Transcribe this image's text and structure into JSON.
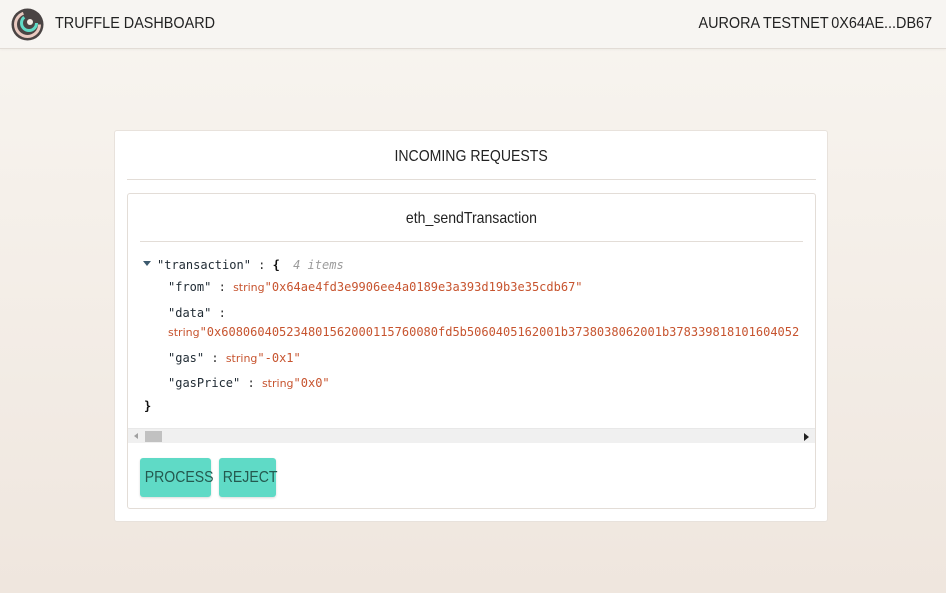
{
  "header": {
    "app_title": "TRUFFLE DASHBOARD",
    "network": "AURORA TESTNET",
    "account": "0X64AE...DB67"
  },
  "panel": {
    "title": "INCOMING REQUESTS"
  },
  "request": {
    "method": "eth_sendTransaction",
    "json": {
      "root_key": "\"transaction\"",
      "root_colon": ":",
      "open_brace": "{",
      "item_count": "4 items",
      "close_brace": "}",
      "fields": [
        {
          "key": "\"from\"",
          "colon": ":",
          "type": "string",
          "value": "\"0x64ae4fd3e9906ee4a0189e3a393d19b3e35cdb67\""
        },
        {
          "key": "\"data\"",
          "colon": ":",
          "type": "string",
          "value": "\"0x608060405234801562000115760080fd5b5060405162001b3738038062001b378339818101604052"
        },
        {
          "key": "\"gas\"",
          "colon": ":",
          "type": "string",
          "value": "\"-0x1\""
        },
        {
          "key": "\"gasPrice\"",
          "colon": ":",
          "type": "string",
          "value": "\"0x0\""
        }
      ]
    }
  },
  "actions": {
    "process_label": "PROCESS",
    "reject_label": "REJECT"
  },
  "colors": {
    "accent": "#5fdac6",
    "string_value": "#c7542f"
  }
}
